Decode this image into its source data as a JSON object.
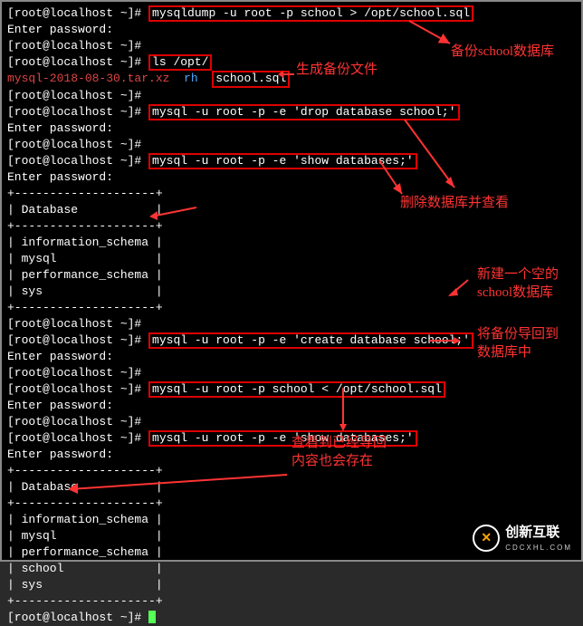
{
  "prompt": "[root@localhost ~]#",
  "enter_pwd": "Enter password:",
  "cmds": {
    "dump": "mysqldump -u root -p school > /opt/school.sql",
    "ls": "ls /opt/",
    "drop": "mysql -u root -p -e 'drop database school;'",
    "show1": "mysql -u root -p -e 'show databases;'",
    "create": "mysql -u root -p -e 'create database school;'",
    "import": "mysql -u root -p school < /opt/school.sql",
    "show2": "mysql -u root -p -e 'show databases;'"
  },
  "ls_output": {
    "f1": "mysql-2018-08-30.tar.xz",
    "f2": "rh",
    "f3": "school.sql"
  },
  "table": {
    "sep_long": "+--------------------+",
    "header": "| Database           |",
    "rows": {
      "info": "| information_schema |",
      "mysql": "| mysql              |",
      "perf": "| performance_schema |",
      "sys": "| sys                |",
      "school": "| school             |"
    }
  },
  "annotations": {
    "backup": "备份school数据库",
    "genfile": "生成备份文件",
    "delview": "删除数据库并查看",
    "newempty1": "新建一个空的",
    "newempty2": "school数据库",
    "importback1": "将备份导回到",
    "importback2": "数据库中",
    "verify1": "查看到已经导回",
    "verify2": "内容也会存在"
  },
  "logo": {
    "main": "创新互联",
    "sub": "CDCXHL.COM"
  }
}
